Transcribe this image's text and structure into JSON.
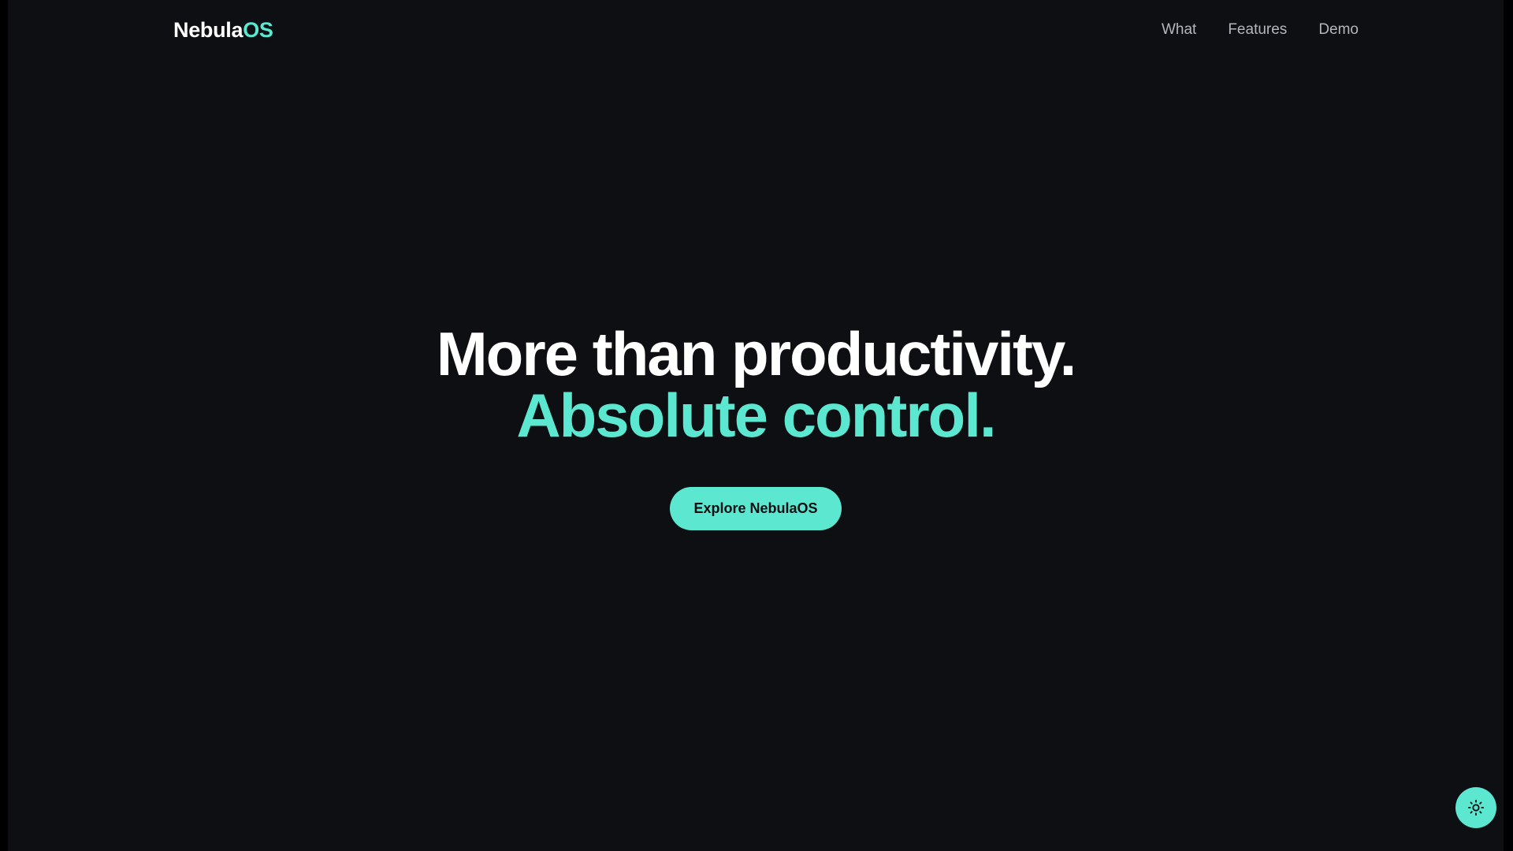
{
  "brand": {
    "name": "Nebula",
    "accent": "OS"
  },
  "nav": {
    "links": [
      "What",
      "Features",
      "Demo"
    ]
  },
  "hero": {
    "headline_line1": "More than productivity.",
    "headline_line2": "Absolute control.",
    "cta_label": "Explore NebulaOS"
  },
  "theme_toggle": {
    "icon": "sun-icon"
  },
  "colors": {
    "background": "#0e0f12",
    "accent": "#5be7d0",
    "text": "#ffffff",
    "nav_text": "#b4b6bd"
  }
}
